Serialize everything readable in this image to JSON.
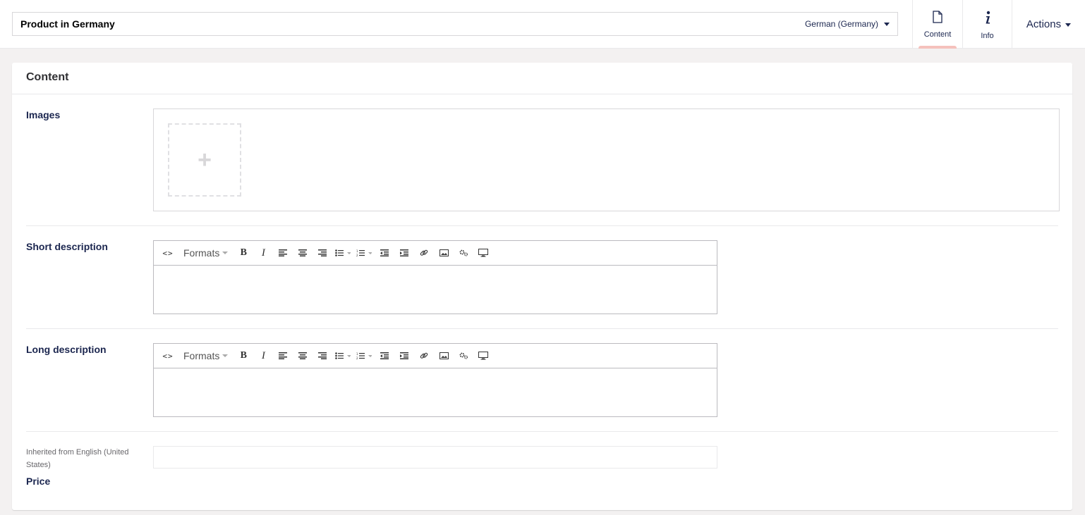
{
  "header": {
    "node_name": "Product in Germany",
    "culture_label": "German (Germany)",
    "tabs": [
      {
        "label": "Content",
        "icon": "document-icon",
        "active": true
      },
      {
        "label": "Info",
        "icon": "info-icon",
        "active": false
      }
    ],
    "actions_label": "Actions"
  },
  "panel": {
    "title": "Content",
    "properties": {
      "images": {
        "label": "Images"
      },
      "short_description": {
        "label": "Short description"
      },
      "long_description": {
        "label": "Long description"
      },
      "price": {
        "label": "Price",
        "inherited_note": "Inherited from English (United States)",
        "value": ""
      }
    },
    "toolbar": {
      "formats_label": "Formats",
      "bold_label": "B",
      "italic_label": "I",
      "code_label": "<>",
      "buttons": [
        "source-code-icon",
        "formats-dropdown",
        "bold-icon",
        "italic-icon",
        "align-left-icon",
        "align-center-icon",
        "align-right-icon",
        "bullet-list-icon",
        "numbered-list-icon",
        "outdent-icon",
        "indent-icon",
        "link-icon",
        "image-icon",
        "macro-icon",
        "embed-icon"
      ]
    }
  },
  "colors": {
    "accent_indicator": "#f5c1bc",
    "text": "#1b264f",
    "background": "#f3f1f1"
  }
}
